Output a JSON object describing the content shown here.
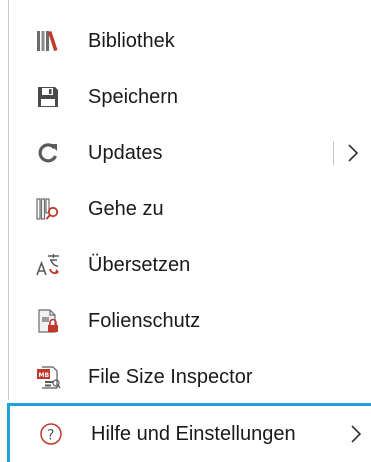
{
  "menu": {
    "items": [
      {
        "label": "Bibliothek",
        "icon": "library-books-icon"
      },
      {
        "label": "Speichern",
        "icon": "save-floppy-icon"
      },
      {
        "label": "Updates",
        "icon": "refresh-icon",
        "has_submenu": true
      },
      {
        "label": "Gehe zu",
        "icon": "goto-search-books-icon"
      },
      {
        "label": "Übersetzen",
        "icon": "translate-icon"
      },
      {
        "label": "Folienschutz",
        "icon": "slide-lock-icon"
      },
      {
        "label": "File Size Inspector",
        "icon": "file-size-inspector-icon"
      },
      {
        "label": "Hilfe und Einstellungen",
        "icon": "help-circle-icon",
        "has_submenu": true,
        "selected": true
      }
    ]
  },
  "colors": {
    "text": "#1a1a1a",
    "accent_red": "#c0392b",
    "icon_gray": "#5a5a5a",
    "selection_border": "#1ea2d8",
    "separator": "#c8c8c8"
  }
}
